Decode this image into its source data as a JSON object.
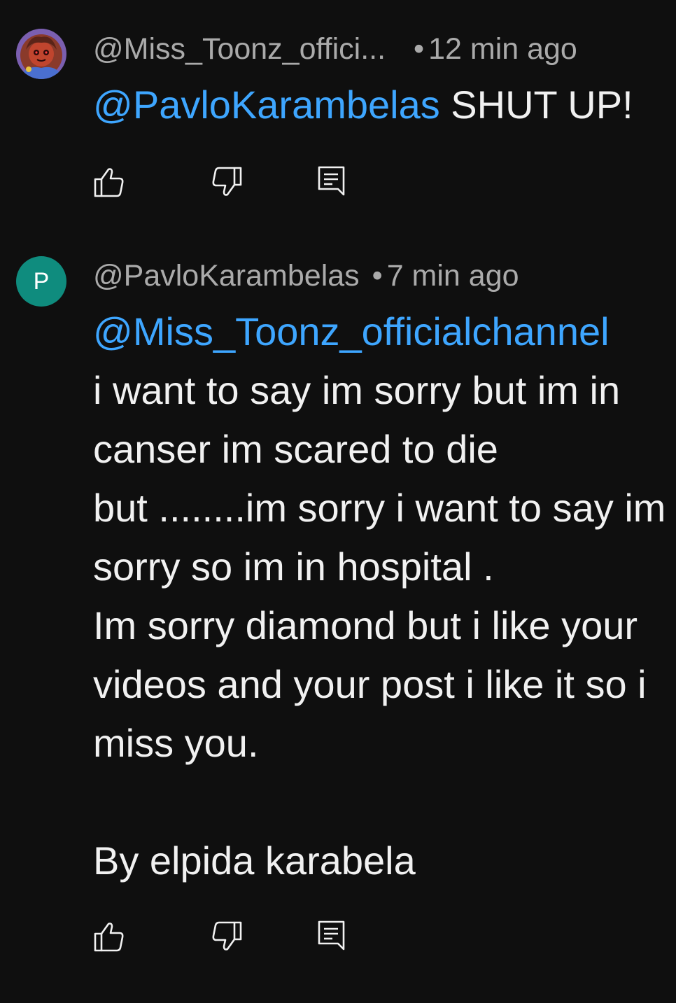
{
  "comments": [
    {
      "author": "@Miss_Toonz_offici...",
      "separator": "•",
      "time": "12 min ago",
      "mention": "@PavloKarambelas",
      "text": " SHUT UP!",
      "avatar_type": "illustrated-avatar"
    },
    {
      "author": "@PavloKarambelas",
      "separator": "•",
      "time": "7 min ago",
      "avatar_letter": "P",
      "avatar_color": "#0f8c7e",
      "mention": "@Miss_Toonz_officialchannel",
      "text": "i want to say im sorry but im in canser im scared to die\nbut ........im sorry i want to say im sorry so im in hospital .\nIm sorry diamond but i like your videos and your post i like it so i miss you.\n\nBy elpida karabela"
    }
  ],
  "icons": {
    "like": "thumb-up-icon",
    "dislike": "thumb-down-icon",
    "reply": "reply-comment-icon"
  },
  "colors": {
    "background": "#0f0f0f",
    "mention": "#3ea6ff",
    "meta": "#aaaaaa",
    "text": "#f1f1f1"
  }
}
